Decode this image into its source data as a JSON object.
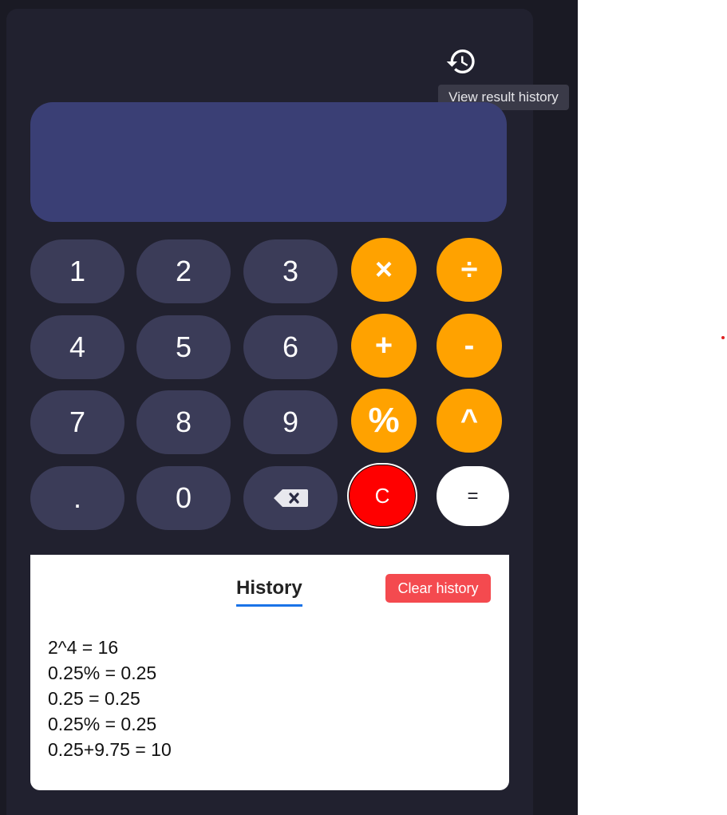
{
  "header": {
    "history_icon": "history-icon",
    "tooltip": "View result history"
  },
  "display": {
    "value": ""
  },
  "keypad": {
    "k1": "1",
    "k2": "2",
    "k3": "3",
    "mul": "×",
    "div": "÷",
    "k4": "4",
    "k5": "5",
    "k6": "6",
    "add": "+",
    "sub": "-",
    "k7": "7",
    "k8": "8",
    "k9": "9",
    "percent": "%",
    "power": "^",
    "dot": ".",
    "k0": "0",
    "backspace_icon": "backspace-icon",
    "clear": "C",
    "equals": "="
  },
  "history": {
    "title": "History",
    "clear_label": "Clear history",
    "entries": [
      "2^4 = 16",
      "0.25% = 0.25",
      "0.25 = 0.25",
      "0.25% = 0.25",
      "0.25+9.75 = 10"
    ]
  },
  "colors": {
    "panel": "#21212f",
    "display": "#3a3f75",
    "number_key": "#3b3c58",
    "operator_key": "#ffa200",
    "clear_key": "#ff0000",
    "clear_history": "#f44a4f",
    "accent_underline": "#1a73e8"
  }
}
